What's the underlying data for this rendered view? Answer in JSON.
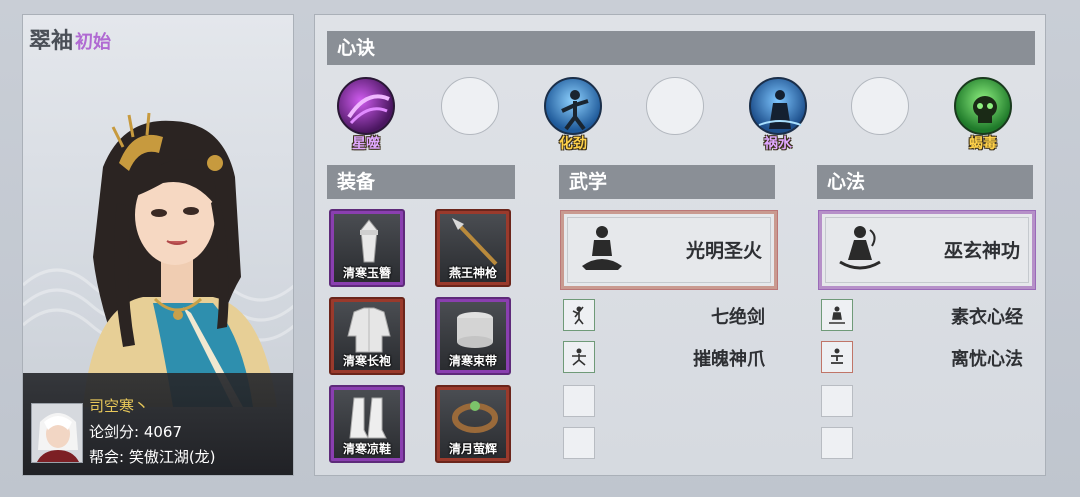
{
  "character": {
    "name": "翠袖",
    "status_tag": "初始"
  },
  "player": {
    "name": "司空寒丶",
    "score": "论剑分: 4067",
    "guild": "帮会: 笑傲江湖(龙)"
  },
  "sections": {
    "xinjue": "心诀",
    "equipment": "装备",
    "martial": "武学",
    "mental": "心法"
  },
  "xinjue_slots": [
    {
      "label": "星噬",
      "label_color": "#e0a8ff",
      "orb": "purple-vortex-icon"
    },
    {
      "label": "",
      "orb": "empty"
    },
    {
      "label": "化劲",
      "label_color": "#ffd24a",
      "orb": "blue-fighter-icon"
    },
    {
      "label": "",
      "orb": "empty"
    },
    {
      "label": "祸水",
      "label_color": "#e0a8ff",
      "orb": "blue-figure-icon"
    },
    {
      "label": "",
      "orb": "empty"
    },
    {
      "label": "蝎毒",
      "label_color": "#ffd24a",
      "orb": "green-skull-icon"
    }
  ],
  "equipment": [
    {
      "name": "清寒玉簪",
      "rarity": "purple"
    },
    {
      "name": "燕王神枪",
      "rarity": "red"
    },
    {
      "name": "清寒长袍",
      "rarity": "red"
    },
    {
      "name": "清寒束带",
      "rarity": "purple"
    },
    {
      "name": "清寒凉鞋",
      "rarity": "purple"
    },
    {
      "name": "清月萤辉",
      "rarity": "red"
    }
  ],
  "martial": {
    "main": "光明圣火",
    "skills": [
      "七绝剑",
      "摧魄神爪"
    ]
  },
  "mental": {
    "main": "巫玄神功",
    "skills": [
      "素衣心经",
      "离忧心法"
    ]
  },
  "colors": {
    "header_bg": "#8a8f96",
    "purple_rarity": "#8a3fb0",
    "red_rarity": "#9a3a2c",
    "tag_purple": "#b06ad2",
    "player_name": "#e8c85a"
  }
}
